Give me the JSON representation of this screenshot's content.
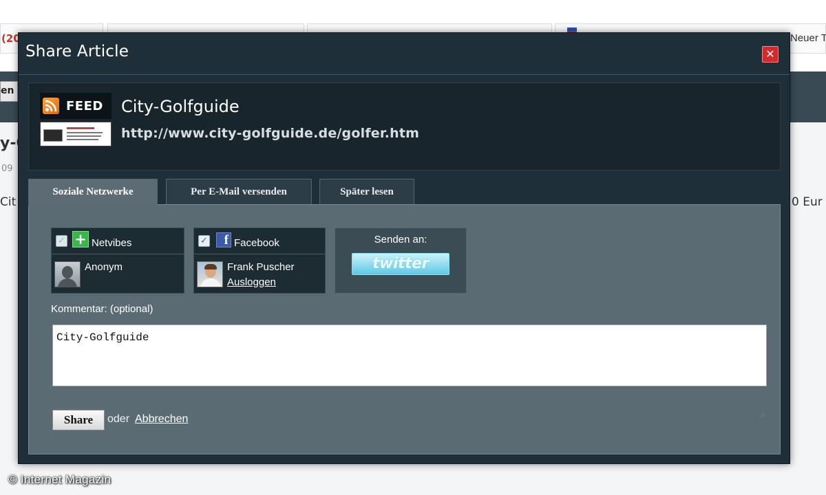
{
  "background": {
    "tab_left_text": "(20",
    "tab_right_text": "Neuer T",
    "nav_button_text": "en",
    "title_fragment": "y-G",
    "date_fragment": "09",
    "body_fragment": "Cit",
    "price_fragment": "0 Eur"
  },
  "modal": {
    "title": "Share Article",
    "close_label": "✕",
    "feed": {
      "badge_label": "FEED",
      "name": "City-Golfguide",
      "url": "http://www.city-golfguide.de/golfer.htm"
    },
    "tabs": [
      {
        "label": "Soziale Netzwerke",
        "active": true
      },
      {
        "label": "Per E-Mail versenden",
        "active": false
      },
      {
        "label": "Später lesen",
        "active": false
      }
    ],
    "networks": {
      "netvibes": {
        "name": "Netvibes",
        "checked": true,
        "icon": "netvibes-icon",
        "account": "Anonym"
      },
      "facebook": {
        "name": "Facebook",
        "checked": true,
        "icon": "facebook-icon",
        "account": "Frank Puscher",
        "logout": "Ausloggen"
      }
    },
    "send_to": {
      "label": "Senden an:",
      "twitter_label": "twitter"
    },
    "comment": {
      "label": "Kommentar: (optional)",
      "value": "City-Golfguide"
    },
    "actions": {
      "share_label": "Share",
      "or_text": "oder",
      "cancel_label": "Abbrechen"
    }
  },
  "watermark": "© Internet Magazin",
  "colors": {
    "modal_bg": "#1f2f3a",
    "panel_bg": "#5b6b74",
    "close_red": "#d42a2a",
    "twitter_blue": "#5ec8e5",
    "rss_orange": "#f08a24"
  }
}
